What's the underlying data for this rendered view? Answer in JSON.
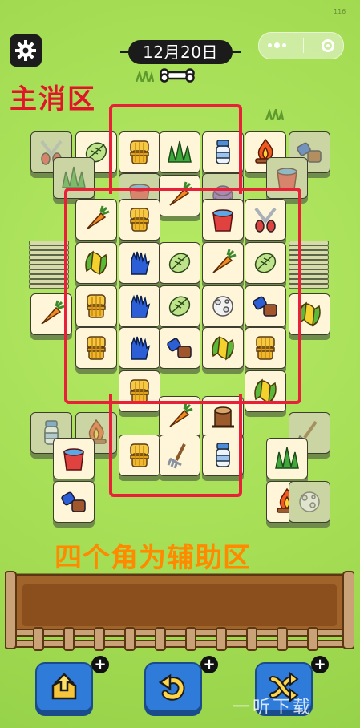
{
  "status": {
    "fps": "116"
  },
  "header": {
    "date": "12月20日"
  },
  "labels": {
    "main_zone": "主消区",
    "aux_zone": "四个角为辅助区"
  },
  "watermark": {
    "text": "一听下载"
  },
  "colors": {
    "annotation_red": "#e8203a",
    "annotation_orange": "#ff8a00",
    "button_blue": "#2e7bd9"
  },
  "tiles": {
    "top_left_cluster": [
      "scissors",
      "cabbage",
      "grass"
    ],
    "top_right_cluster": [
      "fire",
      "brush",
      "bucket"
    ],
    "main_area": [
      "wheat",
      "grass",
      "milk",
      "bucket",
      "carrot",
      "yarn",
      "carrot",
      "wheat",
      "bucket",
      "scissors",
      "corn",
      "glove",
      "cabbage",
      "carrot",
      "cabbage",
      "carrot",
      "wheat",
      "glove",
      "cabbage",
      "cotton",
      "brush",
      "corn",
      "wheat",
      "glove",
      "brush",
      "corn",
      "wheat",
      "wheat",
      "stump",
      "corn",
      "carrot",
      "wheat",
      "rake",
      "milk"
    ],
    "bottom_left_cluster": [
      "milk",
      "fire",
      "bucket",
      "brush"
    ],
    "bottom_right_cluster": [
      "shovel",
      "grass",
      "fire",
      "cotton"
    ]
  },
  "buttons": [
    {
      "name": "move-out",
      "icon": "tile-up-arrow-icon"
    },
    {
      "name": "undo",
      "icon": "undo-arrow-icon"
    },
    {
      "name": "shuffle",
      "icon": "shuffle-arrows-icon"
    }
  ]
}
